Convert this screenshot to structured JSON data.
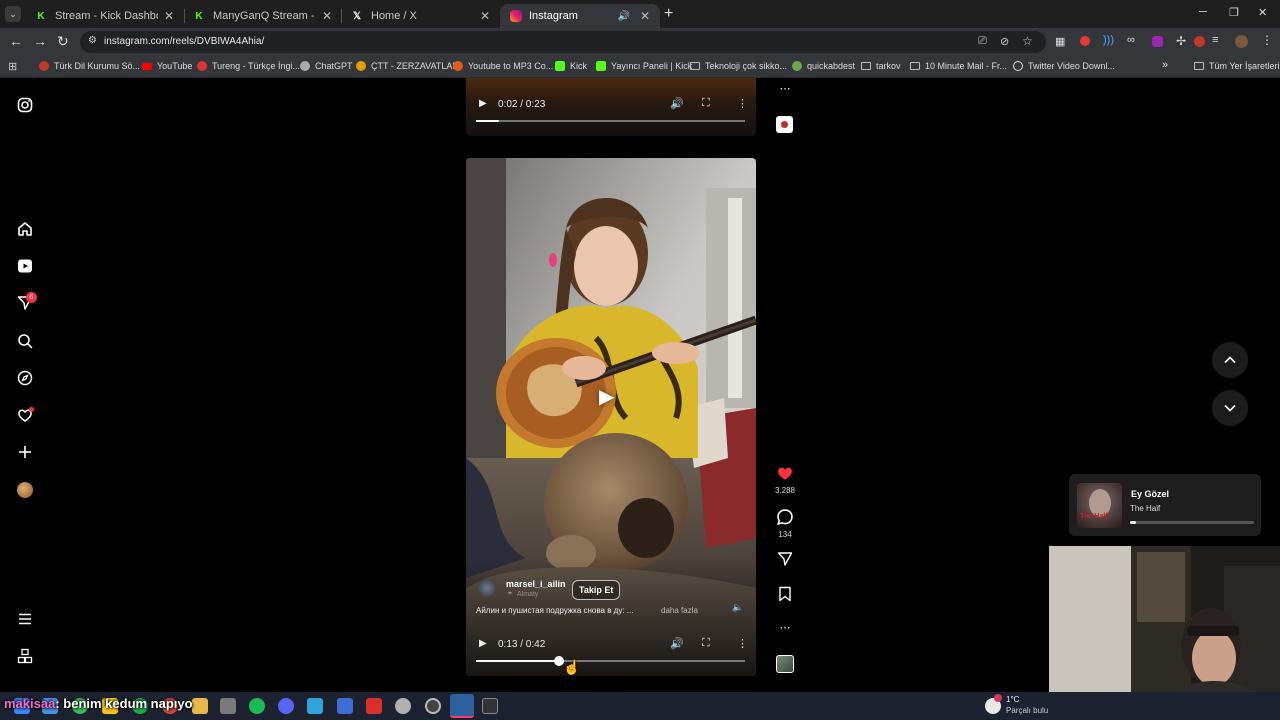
{
  "browser": {
    "tabs": [
      {
        "title": "Stream - Kick Dashboard",
        "icon": "kick-icon"
      },
      {
        "title": "ManyGanQ Stream - Watch Live",
        "icon": "kick-icon"
      },
      {
        "title": "Home / X",
        "icon": "x-logo-icon"
      },
      {
        "title": "Instagram",
        "icon": "instagram-icon"
      }
    ],
    "url": "instagram.com/reels/DVBIWA4Ahia/",
    "bookmarks": [
      {
        "label": "Türk Dil Kurumu Sö...",
        "color": "#c0392b"
      },
      {
        "label": "YouTube",
        "color": "#ff0000"
      },
      {
        "label": "Tureng - Türkçe İngi...",
        "color": "#d33"
      },
      {
        "label": "ChatGPT",
        "color": "#aaaaaa"
      },
      {
        "label": "ÇTT - ZERZAVATLAR",
        "color": "#e0a000"
      },
      {
        "label": "Youtube to MP3 Co...",
        "color": "#e05a1e"
      },
      {
        "label": "Kick",
        "color": "#53fc18"
      },
      {
        "label": "Yayıncı Paneli | Kick",
        "color": "#53fc18"
      },
      {
        "label": "Teknoloji çok sikko...",
        "color": "#999999"
      },
      {
        "label": "quickabdest",
        "color": "#6aa84f"
      },
      {
        "label": "tarkov",
        "color": "#999999"
      },
      {
        "label": "10 Minute Mail - Fr...",
        "color": "#999999"
      },
      {
        "label": "Twitter Video Downl...",
        "color": "#dddddd"
      }
    ],
    "bookmarks_more": "»",
    "all_bookmarks": "Tüm Yer İşaretleri"
  },
  "sidebar": {
    "notification_badge": "6"
  },
  "top_reel": {
    "time": "0:02 / 0:23",
    "progress": 0.087
  },
  "reel": {
    "username": "marsel_i_ailin",
    "location": "Almaty",
    "follow_label": "Takip Et",
    "caption": "Айлин и пушистая подружка снова в ду: ...",
    "more_label": "daha fazla",
    "time": "0:13 / 0:42",
    "progress": 0.31
  },
  "actions": {
    "likes": "3.288",
    "comments": "134"
  },
  "music": {
    "title": "Ey Gözel",
    "artist": "The Half",
    "album_text": "The Half",
    "progress": 0.05
  },
  "chat_overlay": {
    "user": "makisaa",
    "message": ": benim kedum napıyo"
  },
  "taskbar": {
    "weather": "1°C",
    "weather_desc": "Parçalı bulutlu"
  },
  "colors": {
    "like": "#ff3040",
    "kick_green": "#53fc18",
    "accent_blue": "#4aa3ff"
  }
}
